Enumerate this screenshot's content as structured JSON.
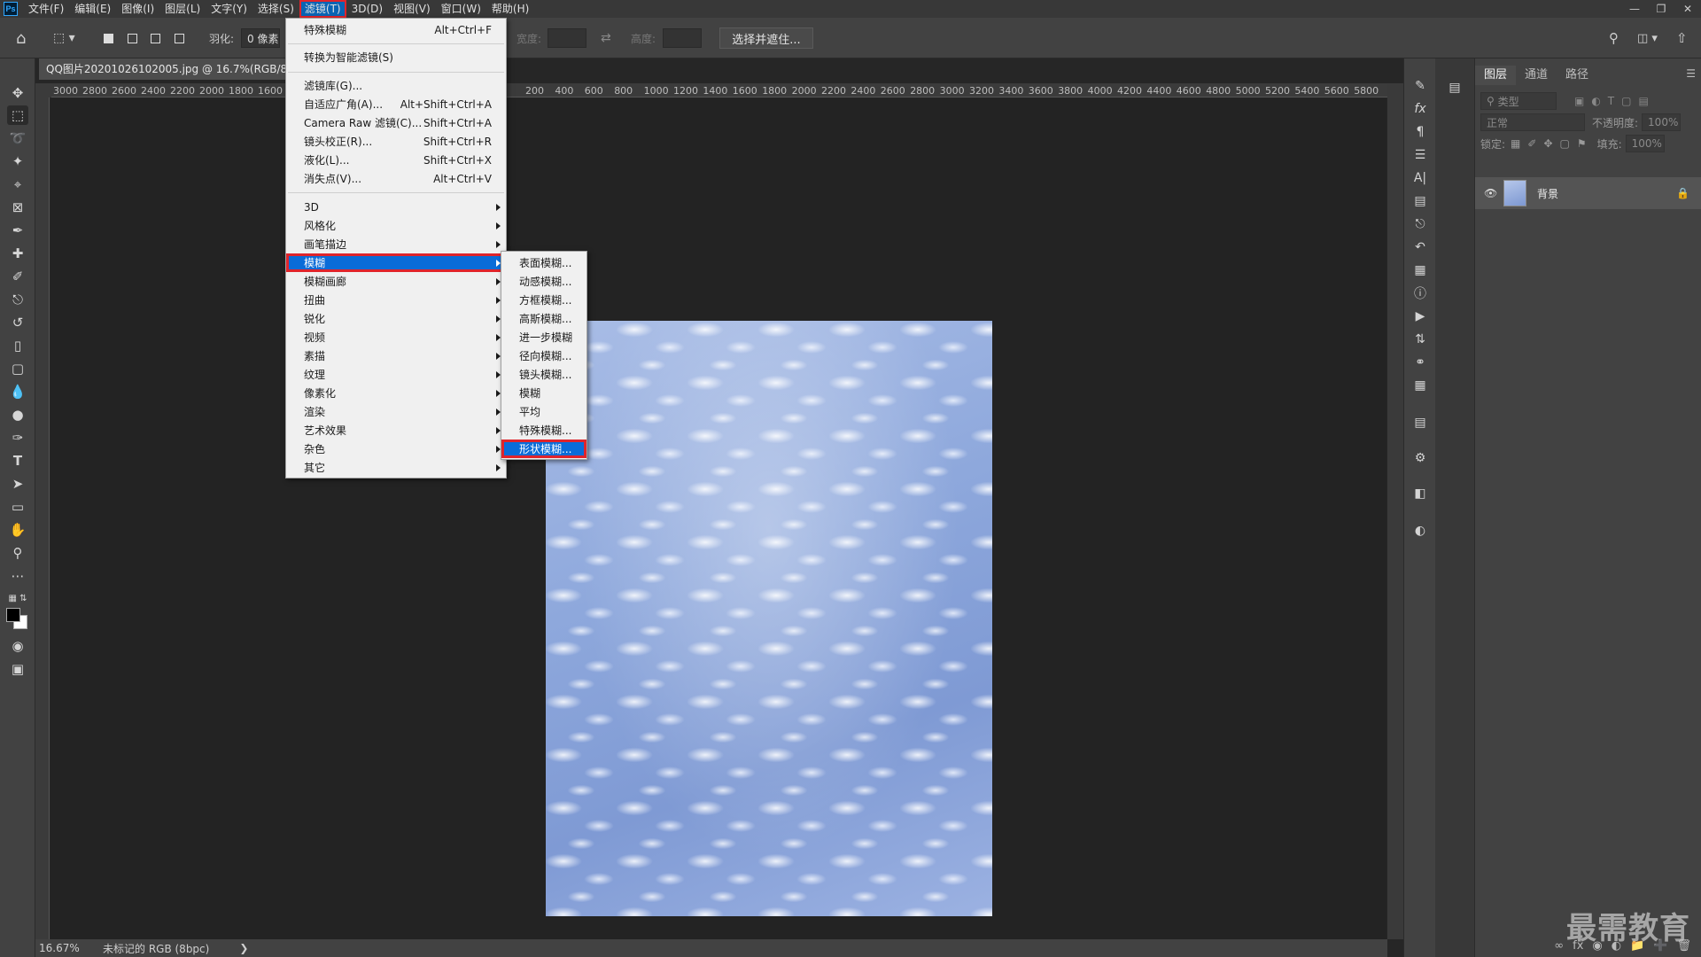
{
  "app": {
    "logo": "Ps",
    "menus": [
      "文件(F)",
      "编辑(E)",
      "图像(I)",
      "图层(L)",
      "文字(Y)",
      "选择(S)",
      "滤镜(T)",
      "3D(D)",
      "视图(V)",
      "窗口(W)",
      "帮助(H)"
    ],
    "active_menu": "滤镜(T)"
  },
  "options_bar": {
    "feather_label": "羽化:",
    "feather_value": "0 像素",
    "width_label": "宽度:",
    "height_label": "高度:",
    "select_mask_button": "选择并遮住..."
  },
  "document": {
    "tab_title": "QQ图片20201026102005.jpg @ 16.7%(RGB/8#)",
    "zoom": "16.67%",
    "color_profile": "未标记的 RGB (8bpc)"
  },
  "ruler": {
    "ticks_left": [
      "3000",
      "2800",
      "2600",
      "2400",
      "2200",
      "2000",
      "1800",
      "1600"
    ],
    "ticks_right": [
      "200",
      "400",
      "600",
      "800",
      "1000",
      "1200",
      "1400",
      "1600",
      "1800",
      "2000",
      "2200",
      "2400",
      "2600",
      "2800",
      "3000",
      "3200",
      "3400",
      "3600",
      "3800",
      "4000",
      "4200",
      "4400",
      "4600",
      "4800",
      "5000",
      "5200",
      "5400",
      "5600",
      "5800"
    ]
  },
  "filter_menu": {
    "items": [
      {
        "label": "特殊模糊",
        "shortcut": "Alt+Ctrl+F"
      },
      {
        "label": "转换为智能滤镜(S)",
        "shortcut": ""
      },
      {
        "label": "滤镜库(G)...",
        "shortcut": ""
      },
      {
        "label": "自适应广角(A)...",
        "shortcut": "Alt+Shift+Ctrl+A"
      },
      {
        "label": "Camera Raw 滤镜(C)...",
        "shortcut": "Shift+Ctrl+A"
      },
      {
        "label": "镜头校正(R)...",
        "shortcut": "Shift+Ctrl+R"
      },
      {
        "label": "液化(L)...",
        "shortcut": "Shift+Ctrl+X"
      },
      {
        "label": "消失点(V)...",
        "shortcut": "Alt+Ctrl+V"
      },
      {
        "label": "3D"
      },
      {
        "label": "风格化"
      },
      {
        "label": "画笔描边"
      },
      {
        "label": "模糊"
      },
      {
        "label": "模糊画廊"
      },
      {
        "label": "扭曲"
      },
      {
        "label": "锐化"
      },
      {
        "label": "视频"
      },
      {
        "label": "素描"
      },
      {
        "label": "纹理"
      },
      {
        "label": "像素化"
      },
      {
        "label": "渲染"
      },
      {
        "label": "艺术效果"
      },
      {
        "label": "杂色"
      },
      {
        "label": "其它"
      }
    ],
    "highlighted": "模糊"
  },
  "blur_submenu": {
    "items": [
      "表面模糊...",
      "动感模糊...",
      "方框模糊...",
      "高斯模糊...",
      "进一步模糊",
      "径向模糊...",
      "镜头模糊...",
      "模糊",
      "平均",
      "特殊模糊...",
      "形状模糊..."
    ],
    "highlighted": "形状模糊..."
  },
  "layers_panel": {
    "tabs": [
      "图层",
      "通道",
      "路径"
    ],
    "active_tab": "图层",
    "filter_placeholder": "类型",
    "blend_mode": "正常",
    "opacity_label": "不透明度:",
    "opacity_value": "100%",
    "lock_label": "锁定:",
    "fill_label": "填充:",
    "fill_value": "100%",
    "layer_name": "背景"
  },
  "watermark": "最需教育",
  "colors": {
    "menu_highlight": "#0a6cd8",
    "annotation_red": "#e0242b",
    "panel_bg": "#424242",
    "canvas_bg": "#232323"
  }
}
